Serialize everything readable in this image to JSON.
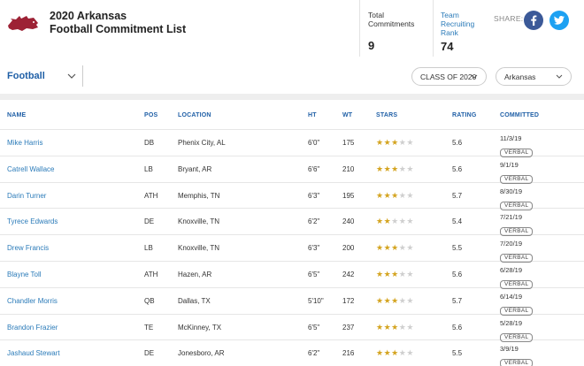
{
  "header": {
    "title_line1": "2020 Arkansas",
    "title_line2": "Football Commitment List",
    "total_commitments_label_line1": "Total",
    "total_commitments_label_line2": "Commitments",
    "total_commitments_value": "9",
    "team_rank_label_line1": "Team",
    "team_rank_label_line2": "Recruiting",
    "team_rank_label_line3": "Rank",
    "team_rank_value": "74",
    "share_label": "SHARE:"
  },
  "filters": {
    "sport": "Football",
    "class_select": "CLASS OF 2020",
    "team_select": "Arkansas"
  },
  "columns": {
    "name": "NAME",
    "pos": "POS",
    "location": "LOCATION",
    "ht": "HT",
    "wt": "WT",
    "stars": "STARS",
    "rating": "RATING",
    "committed": "COMMITTED"
  },
  "rows": [
    {
      "name": "Mike Harris",
      "pos": "DB",
      "location": "Phenix City, AL",
      "ht": "6'0\"",
      "wt": "175",
      "stars": 3,
      "rating": "5.6",
      "date": "11/3/19",
      "status": "VERBAL"
    },
    {
      "name": "Catrell Wallace",
      "pos": "LB",
      "location": "Bryant, AR",
      "ht": "6'6\"",
      "wt": "210",
      "stars": 3,
      "rating": "5.6",
      "date": "9/1/19",
      "status": "VERBAL"
    },
    {
      "name": "Darin Turner",
      "pos": "ATH",
      "location": "Memphis, TN",
      "ht": "6'3\"",
      "wt": "195",
      "stars": 3,
      "rating": "5.7",
      "date": "8/30/19",
      "status": "VERBAL"
    },
    {
      "name": "Tyrece Edwards",
      "pos": "DE",
      "location": "Knoxville, TN",
      "ht": "6'2\"",
      "wt": "240",
      "stars": 2,
      "rating": "5.4",
      "date": "7/21/19",
      "status": "VERBAL"
    },
    {
      "name": "Drew Francis",
      "pos": "LB",
      "location": "Knoxville, TN",
      "ht": "6'3\"",
      "wt": "200",
      "stars": 3,
      "rating": "5.5",
      "date": "7/20/19",
      "status": "VERBAL"
    },
    {
      "name": "Blayne Toll",
      "pos": "ATH",
      "location": "Hazen, AR",
      "ht": "6'5\"",
      "wt": "242",
      "stars": 3,
      "rating": "5.6",
      "date": "6/28/19",
      "status": "VERBAL"
    },
    {
      "name": "Chandler Morris",
      "pos": "QB",
      "location": "Dallas, TX",
      "ht": "5'10\"",
      "wt": "172",
      "stars": 3,
      "rating": "5.7",
      "date": "6/14/19",
      "status": "VERBAL"
    },
    {
      "name": "Brandon Frazier",
      "pos": "TE",
      "location": "McKinney, TX",
      "ht": "6'5\"",
      "wt": "237",
      "stars": 3,
      "rating": "5.6",
      "date": "5/28/19",
      "status": "VERBAL"
    },
    {
      "name": "Jashaud Stewart",
      "pos": "DE",
      "location": "Jonesboro, AR",
      "ht": "6'2\"",
      "wt": "216",
      "stars": 3,
      "rating": "5.5",
      "date": "3/9/19",
      "status": "VERBAL"
    }
  ],
  "colors": {
    "accent_blue": "#1f5fa6",
    "link_blue": "#2b7bb9",
    "star_gold": "#d4a420",
    "razorback_red": "#9d2235",
    "facebook": "#3b5998",
    "twitter": "#1da1f2"
  },
  "icons": {
    "logo": "razorback-logo",
    "facebook": "facebook-icon",
    "twitter": "twitter-icon",
    "dropdown": "chevron-down-icon",
    "star": "star-icon"
  }
}
